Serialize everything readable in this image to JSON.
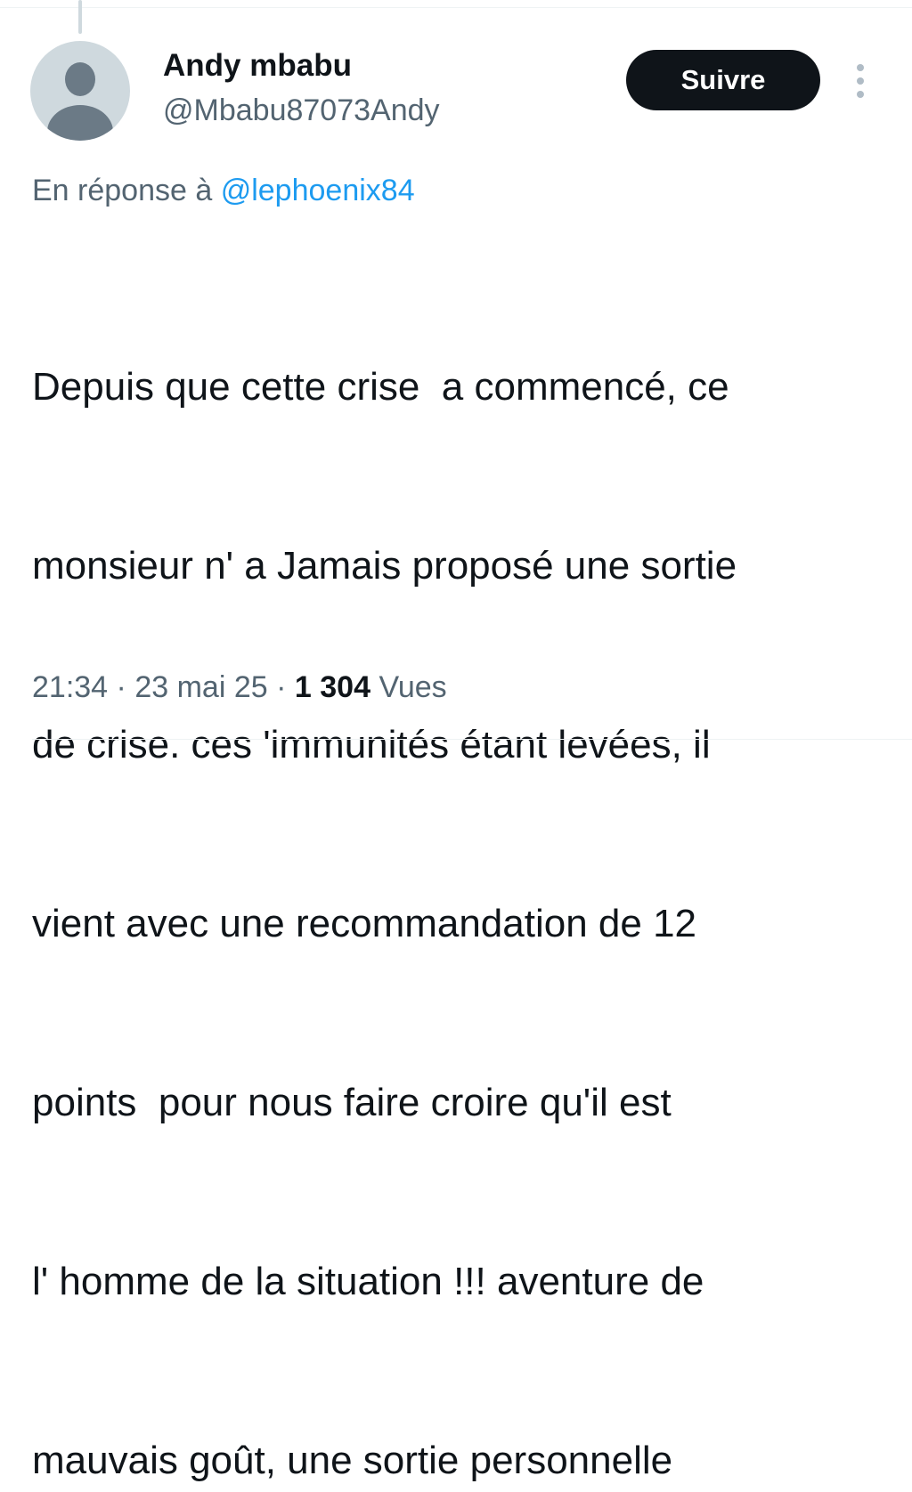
{
  "author": {
    "display_name": "Andy mbabu",
    "handle": "@Mbabu87073Andy"
  },
  "follow_button": {
    "label": "Suivre"
  },
  "more_menu": {
    "icon": "more-vertical-icon"
  },
  "reply": {
    "prefix": "En réponse à ",
    "mention": "@lephoenix84"
  },
  "tweet": {
    "lines": [
      "Depuis que cette crise  a commencé, ce",
      "monsieur n' a Jamais proposé une sortie",
      "de crise. ces 'immunités étant levées, il",
      "vient avec une recommandation de 12",
      "points  pour nous faire croire qu'il est",
      "l' homme de la situation !!! aventure de",
      "mauvais goût, une sortie personnelle"
    ]
  },
  "meta": {
    "time": "21:34",
    "separator": "·",
    "date": "23 mai 25",
    "views_count": "1 304",
    "views_label": "Vues"
  },
  "colors": {
    "text": "#0f1419",
    "secondary": "#536471",
    "link": "#1d9bf0",
    "button_bg": "#0f1419",
    "button_text": "#ffffff"
  }
}
